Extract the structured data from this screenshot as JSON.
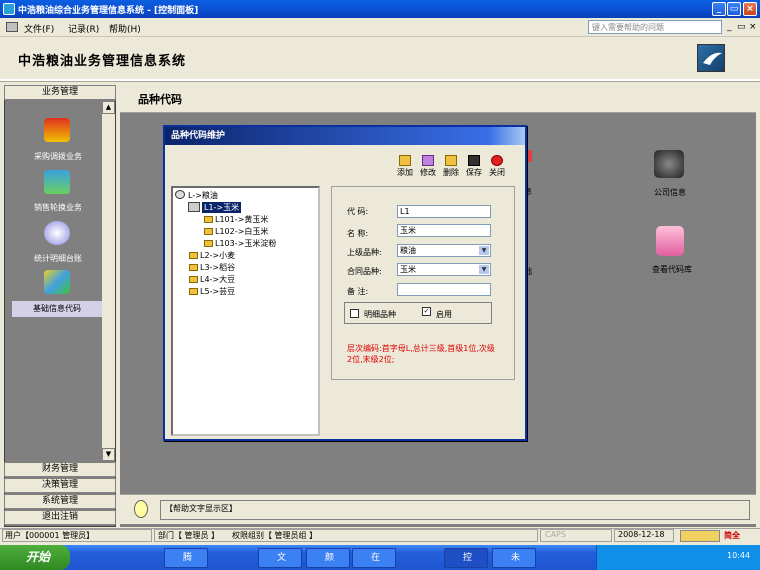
{
  "window": {
    "title": "中浩粮油综合业务管理信息系统 - [控制面板]"
  },
  "menu": {
    "items": [
      "文件(F)",
      "记录(R)",
      "帮助(H)"
    ],
    "help_placeholder": "键入需要帮助的问题"
  },
  "header": {
    "system_name": "中浩粮油业务管理信息系统"
  },
  "nav": {
    "top_group": "业务管理",
    "items": [
      "采购调拨业务",
      "销售轮换业务",
      "统计明细台账",
      "基础信息代码"
    ],
    "bottom_groups": [
      "财务管理",
      "决策管理",
      "系统管理",
      "退出注销"
    ]
  },
  "main": {
    "title": "品种代码",
    "right_items": [
      "公司信息",
      "查看代码库"
    ],
    "partial_labels": [
      "息",
      "础"
    ],
    "help_text": "【帮助文字显示区】"
  },
  "dialog": {
    "title": "品种代码维护",
    "toolbar": [
      "添加",
      "修改",
      "删除",
      "保存",
      "关闭"
    ],
    "tree": {
      "root": "L->粮油",
      "l1": "L1->玉米",
      "l1_children": [
        "L101->黄玉米",
        "L102->白玉米",
        "L103->玉米淀粉"
      ],
      "siblings": [
        "L2->小麦",
        "L3->稻谷",
        "L4->大豆",
        "L5->芸豆"
      ]
    },
    "form": {
      "code_label": "代  码:",
      "code_value": "L1",
      "name_label": "名  称:",
      "name_value": "玉米",
      "parent_label": "上级品种:",
      "parent_value": "粮油",
      "contract_label": "合同品种:",
      "contract_value": "玉米",
      "remark_label": "备  注:",
      "remark_value": "",
      "detail_label": "明细品种",
      "detail_checked": false,
      "enable_label": "启用",
      "enable_checked": true,
      "note": "层次编码:首字母L,总计三级,首级1位,次级2位,末级2位;"
    }
  },
  "status": {
    "user": "用户【000001 管理员】",
    "dept": "部门【 管理员 】",
    "group": "权限组别【 管理员组 】",
    "caps": "CAPS",
    "date": "2008-12-18",
    "ime": "简全"
  },
  "taskbar": {
    "start": "开始",
    "tasks": [
      "腾",
      "文",
      "颜",
      "在",
      "控",
      "未"
    ],
    "clock": "10:44"
  }
}
